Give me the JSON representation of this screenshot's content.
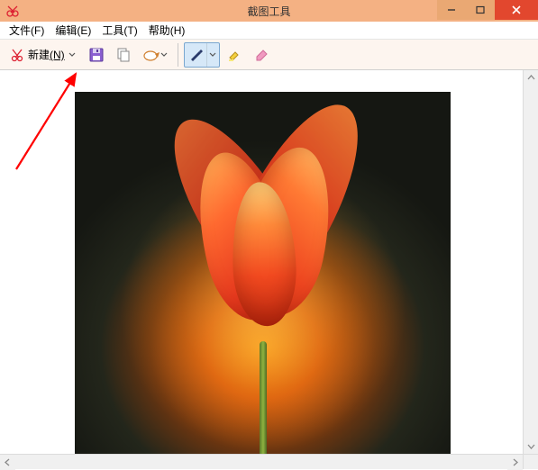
{
  "title": "截图工具",
  "menu": {
    "file": {
      "label": "文件",
      "hotkey": "(F)"
    },
    "edit": {
      "label": "编辑",
      "hotkey": "(E)"
    },
    "tools": {
      "label": "工具",
      "hotkey": "(T)"
    },
    "help": {
      "label": "帮助",
      "hotkey": "(H)"
    }
  },
  "toolbar": {
    "new_label": "新建",
    "new_hotkey": "(N)",
    "icons": {
      "snip": "scissors-icon",
      "save": "save-icon",
      "copy": "copy-icon",
      "email": "email-icon",
      "pen": "pen-icon",
      "highlighter": "highlighter-icon",
      "eraser": "eraser-icon"
    }
  },
  "colors": {
    "titlebar": "#f4b183",
    "close": "#e2472e",
    "accent_blue": "#7aa7d0",
    "annotation": "#ff0000"
  }
}
